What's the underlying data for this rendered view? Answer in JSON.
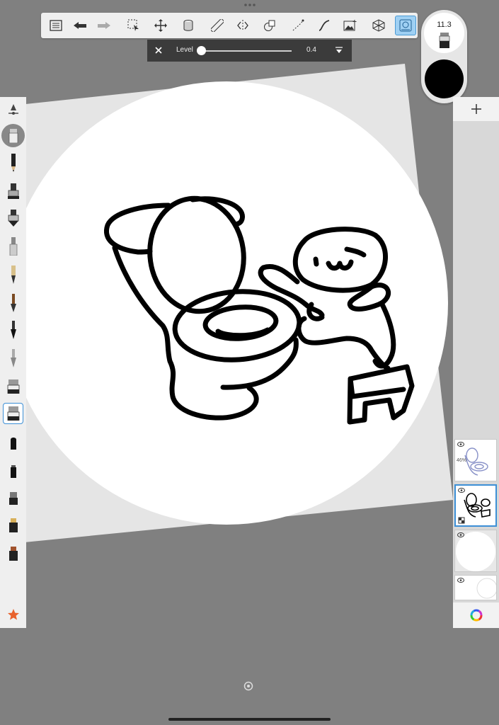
{
  "level_panel": {
    "label": "Level",
    "value": "0.4",
    "slider_fraction": 0.0
  },
  "brush": {
    "size": "11.3",
    "color": "#000000"
  },
  "toolbar": {
    "items": [
      {
        "name": "lists-icon"
      },
      {
        "name": "undo-icon"
      },
      {
        "name": "redo-icon"
      },
      {
        "name": "selection-icon"
      },
      {
        "name": "transform-icon"
      },
      {
        "name": "fill-icon"
      },
      {
        "name": "ruler-icon"
      },
      {
        "name": "symmetry-icon"
      },
      {
        "name": "shapes-icon"
      },
      {
        "name": "steady-stroke-icon"
      },
      {
        "name": "french-curve-icon"
      },
      {
        "name": "image-icon"
      },
      {
        "name": "perspective-guide-icon"
      },
      {
        "name": "predictive-stroke-icon"
      }
    ],
    "active": "predictive-stroke-icon"
  },
  "layers": {
    "items": [
      {
        "name": "layer-1",
        "opacity": "46%",
        "visible": true
      },
      {
        "name": "layer-2",
        "visible": true,
        "selected": true
      },
      {
        "name": "layer-3",
        "visible": true
      },
      {
        "name": "layer-4",
        "visible": true
      }
    ]
  },
  "colors": {
    "accent": "#3c8fd6",
    "panel": "#efefef",
    "workspace": "#808080",
    "favorite_star": "#e8612c"
  }
}
